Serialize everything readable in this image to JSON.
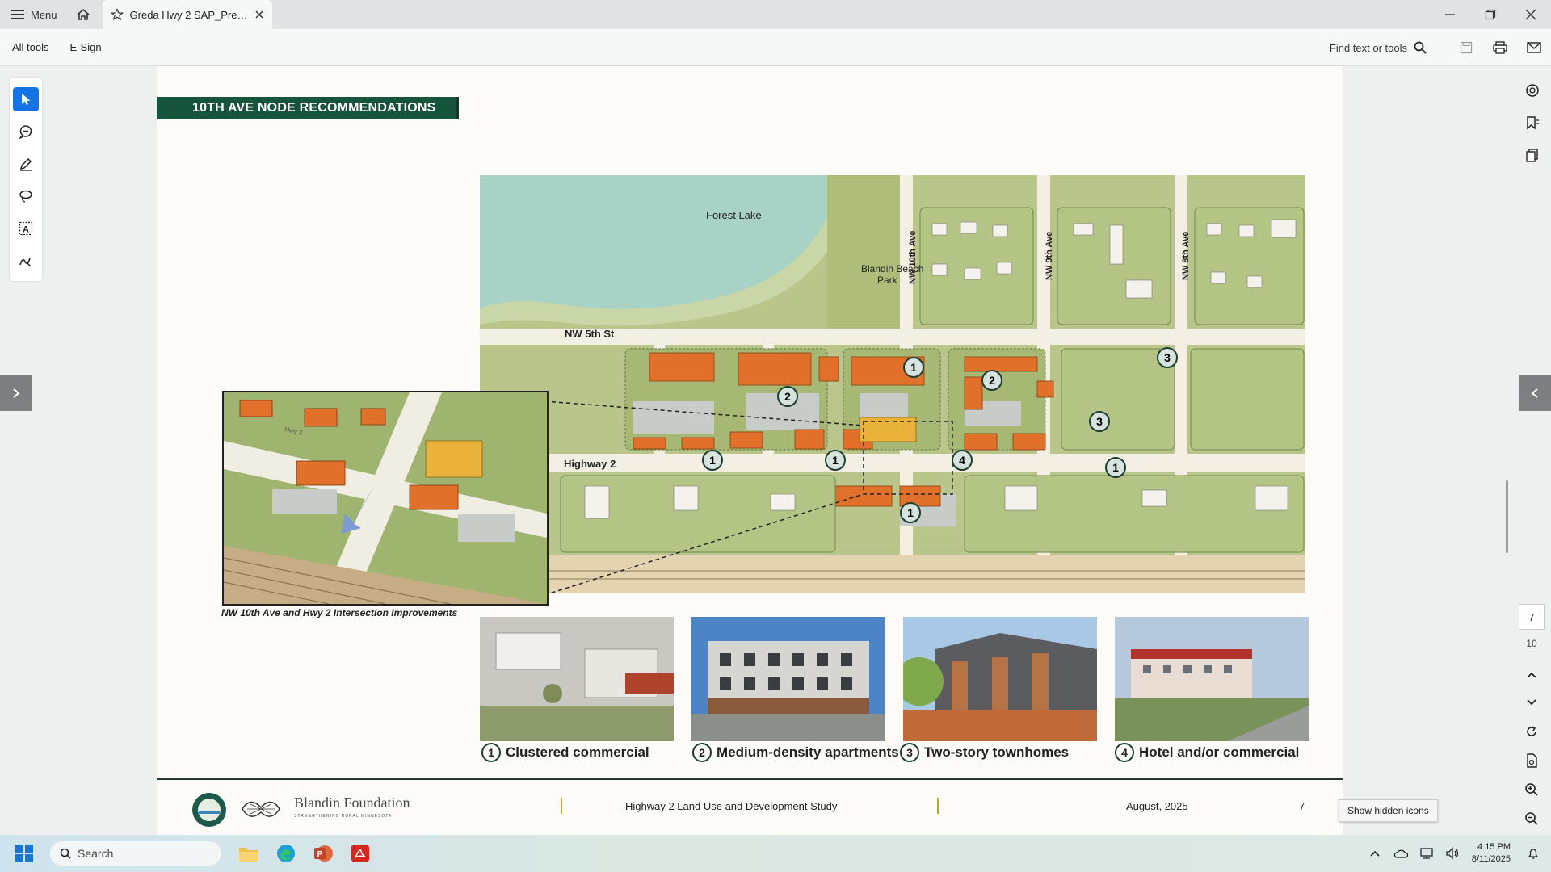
{
  "app": {
    "menu_label": "Menu",
    "tab_title": "Greda Hwy 2 SAP_Pres..."
  },
  "toolbar": {
    "all_tools": "All tools",
    "esign": "E-Sign",
    "find_label": "Find text or tools"
  },
  "document": {
    "banner": "10TH AVE NODE RECOMMENDATIONS",
    "map_labels": {
      "forest_lake": "Forest Lake",
      "blandin_beach_1": "Blandin Beach",
      "blandin_beach_2": "Park",
      "nw_5th_st": "NW 5th St",
      "nw_10th_ave": "NW 10th Ave",
      "nw_9th_ave": "NW 9th Ave",
      "nw_8th_ave": "NW 8th Ave",
      "highway_2": "Highway 2",
      "inset_hwy": "Hwy 2"
    },
    "markers": [
      "1",
      "2",
      "3",
      "4"
    ],
    "inset_caption": "NW 10th Ave and Hwy 2 Intersection Improvements",
    "photos": [
      {
        "num": "1",
        "label": "Clustered commercial"
      },
      {
        "num": "2",
        "label": "Medium-density apartments"
      },
      {
        "num": "3",
        "label": "Two-story townhomes"
      },
      {
        "num": "4",
        "label": "Hotel and/or commercial"
      }
    ],
    "footer": {
      "foundation": "Blandin Foundation",
      "tagline": "STRENGTHENING RURAL MINNESOTA",
      "study": "Highway 2 Land Use and Development Study",
      "date": "August, 2025",
      "page": "7"
    }
  },
  "navigation": {
    "current_page": "7",
    "total_pages": "10"
  },
  "tooltip": "Show hidden icons",
  "taskbar": {
    "search_placeholder": "Search",
    "time": "4:15 PM",
    "date": "8/11/2025"
  },
  "colors": {
    "banner": "#17543d",
    "accent": "#1473e6",
    "building_orange": "#e0702a"
  }
}
